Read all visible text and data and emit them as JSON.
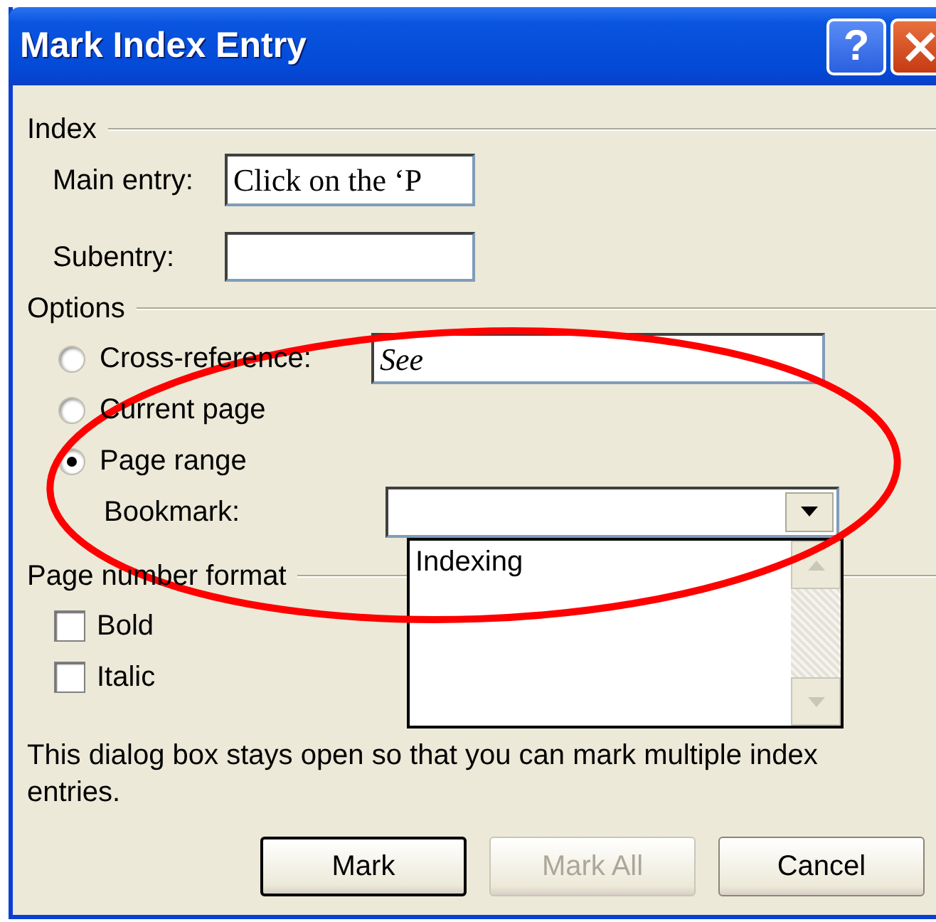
{
  "window": {
    "title": "Mark Index Entry",
    "buttons": [
      {
        "kind": "help",
        "label": "?"
      },
      {
        "kind": "close"
      }
    ]
  },
  "index": {
    "title": "Index",
    "main_entry": {
      "label": "Main entry:",
      "value": "Click on the ‘P"
    },
    "subentry": {
      "label": "Subentry:"
    }
  },
  "options": {
    "title": "Options",
    "choices": [
      {
        "label": "Cross-reference:",
        "selected": false,
        "value": "See"
      },
      {
        "label": "Current page",
        "selected": false
      },
      {
        "label": "Page range",
        "selected": true
      }
    ],
    "bookmark": {
      "label": "Bookmark:",
      "expanded": true,
      "items": [
        "Indexing"
      ]
    }
  },
  "page_number_format": {
    "title": "Page number format",
    "checks": [
      {
        "label": "Bold",
        "checked": false
      },
      {
        "label": "Italic",
        "checked": false
      }
    ]
  },
  "note": "This dialog box stays open so that you can mark multiple index entries.",
  "buttons": [
    {
      "label": "Mark",
      "default": true,
      "disabled": false
    },
    {
      "label": "Mark All",
      "default": false,
      "disabled": true
    },
    {
      "label": "Cancel",
      "default": false,
      "disabled": false
    }
  ],
  "annotations": [
    {
      "kind": "ellipse"
    }
  ]
}
